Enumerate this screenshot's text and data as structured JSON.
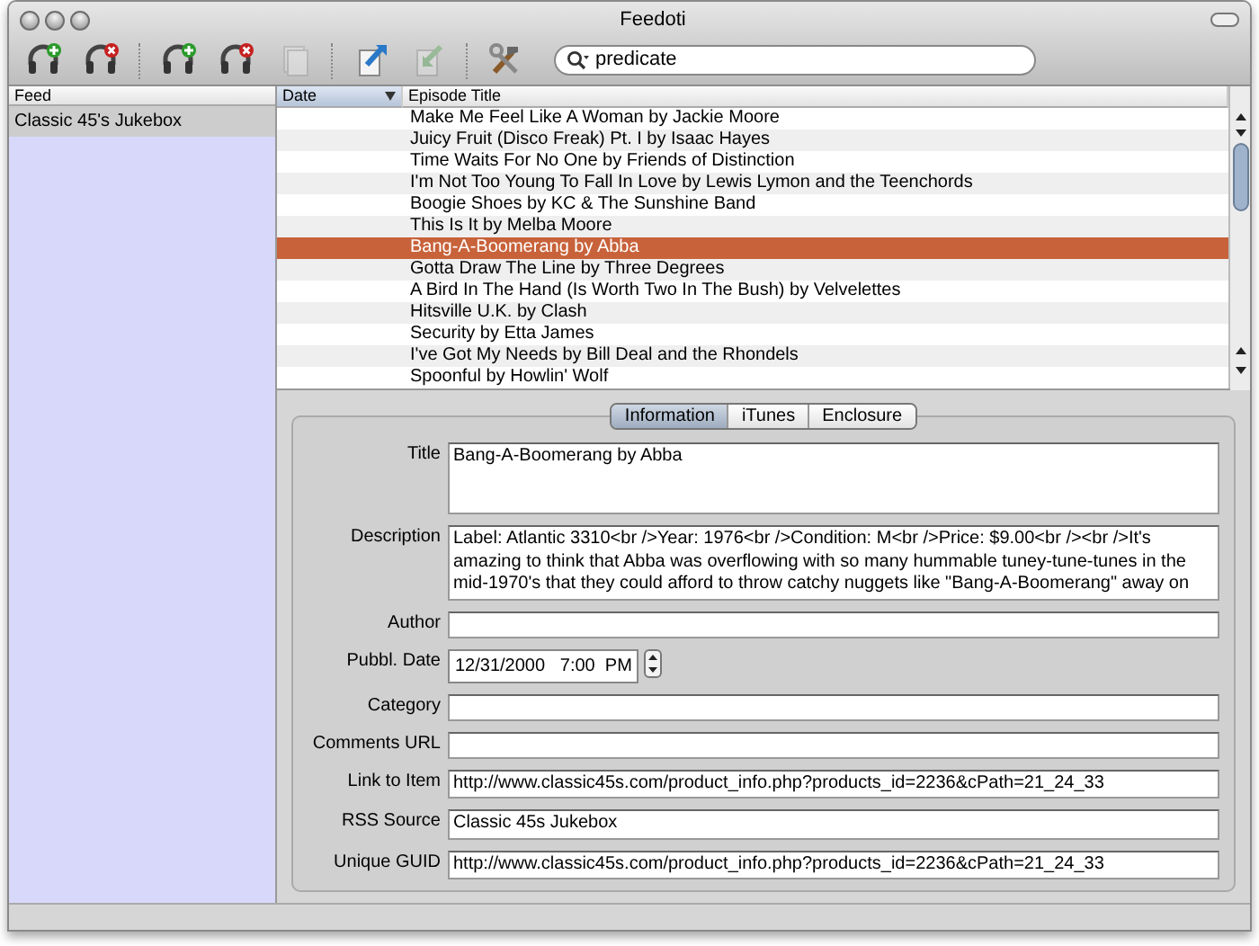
{
  "window": {
    "title": "Feedoti"
  },
  "toolbar": {
    "buttons": [
      {
        "kind": "add",
        "disabled": false
      },
      {
        "kind": "remove",
        "disabled": false
      },
      {
        "kind": "add",
        "disabled": false
      },
      {
        "kind": "remove",
        "disabled": false
      },
      {
        "kind": "page",
        "disabled": true
      },
      {
        "kind": "send",
        "disabled": false
      },
      {
        "kind": "receive",
        "disabled": true
      },
      {
        "kind": "tools",
        "disabled": false
      }
    ],
    "search": {
      "value": "predicate"
    }
  },
  "feeds": {
    "header": "Feed",
    "items": [
      {
        "label": "Classic 45's Jukebox",
        "selected": true
      }
    ]
  },
  "episodes": {
    "columns": [
      {
        "label": "Date",
        "sorted": true
      },
      {
        "label": "Episode Title",
        "sorted": false
      }
    ],
    "rows": [
      {
        "title": "Make Me Feel Like A Woman by Jackie Moore",
        "selected": false
      },
      {
        "title": "Juicy Fruit (Disco Freak) Pt. I by Isaac Hayes",
        "selected": false
      },
      {
        "title": "Time Waits For No One by Friends of Distinction",
        "selected": false
      },
      {
        "title": "I'm Not Too Young To Fall In Love by Lewis Lymon and the Teenchords",
        "selected": false
      },
      {
        "title": "Boogie Shoes by KC & The Sunshine Band",
        "selected": false
      },
      {
        "title": "This Is It by Melba Moore",
        "selected": false
      },
      {
        "title": "Bang-A-Boomerang by Abba",
        "selected": true
      },
      {
        "title": "Gotta Draw The Line by Three Degrees",
        "selected": false
      },
      {
        "title": "A Bird In The Hand (Is Worth Two In The Bush) by Velvelettes",
        "selected": false
      },
      {
        "title": "Hitsville U.K. by Clash",
        "selected": false
      },
      {
        "title": "Security by Etta James",
        "selected": false
      },
      {
        "title": "I've Got My Needs by Bill Deal and the Rhondels",
        "selected": false
      },
      {
        "title": "Spoonful by Howlin' Wolf",
        "selected": false
      }
    ]
  },
  "detail": {
    "tabs": [
      {
        "label": "Information",
        "selected": true
      },
      {
        "label": "iTunes",
        "selected": false
      },
      {
        "label": "Enclosure",
        "selected": false
      }
    ],
    "fields": [
      {
        "label": "Title",
        "kind": "area",
        "value": "Bang-A-Boomerang by Abba"
      },
      {
        "label": "Description",
        "kind": "area",
        "value": "Label: Atlantic 3310<br />Year: 1976<br />Condition: M<br />Price: $9.00<br /><br />It's amazing to think that Abba was overflowing with so many hummable tuney-tune-tunes in the mid-1970's that they could afford to throw catchy nuggets like \"Bang-A-Boomerang\" away on"
      },
      {
        "label": "Author",
        "kind": "text"
      },
      {
        "label": "Pubbl. Date",
        "kind": "date",
        "value": "12/31/2000   7:00  PM"
      },
      {
        "label": "Category",
        "kind": "text"
      },
      {
        "label": "Comments URL",
        "kind": "text"
      },
      {
        "label": "Link to Item",
        "kind": "text",
        "value": "http://www.classic45s.com/product_info.php?products_id=2236&cPath=21_24_33"
      },
      {
        "label": "RSS Source",
        "kind": "text",
        "value": "Classic 45s Jukebox"
      },
      {
        "label": "Unique GUID",
        "kind": "text",
        "value": "http://www.classic45s.com/product_info.php?products_id=2236&cPath=21_24_33"
      }
    ]
  }
}
